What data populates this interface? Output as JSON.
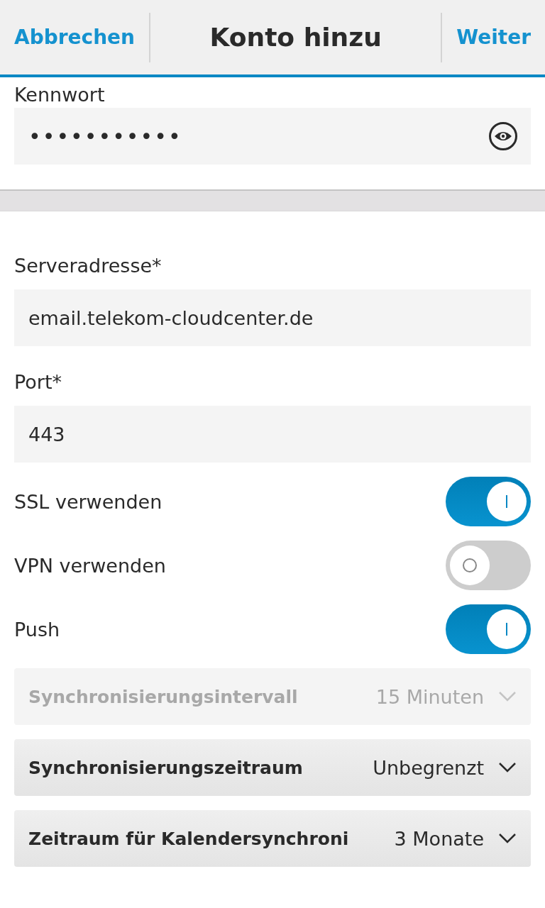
{
  "header": {
    "cancel": "Abbrechen",
    "title": "Konto hinzu",
    "next": "Weiter"
  },
  "password": {
    "label": "Kennwort",
    "value": "•••••••••••"
  },
  "fields": [
    {
      "label": "Serveradresse*",
      "value": "email.telekom-cloudcenter.de"
    },
    {
      "label": "Port*",
      "value": "443"
    }
  ],
  "switches": [
    {
      "label": "SSL verwenden",
      "on": true
    },
    {
      "label": "VPN verwenden",
      "on": false
    },
    {
      "label": "Push",
      "on": true
    }
  ],
  "dropdowns": [
    {
      "label": "Synchronisierungsintervall",
      "value": "15 Minuten",
      "disabled": true
    },
    {
      "label": "Synchronisierungszeitraum",
      "value": "Unbegrenzt",
      "disabled": false
    },
    {
      "label": "Zeitraum für Kalendersynchroni",
      "value": "3 Monate",
      "disabled": false
    }
  ]
}
